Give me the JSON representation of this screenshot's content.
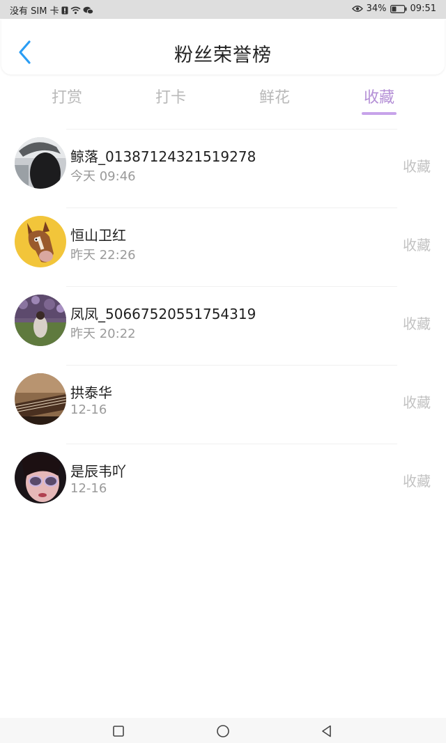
{
  "status_bar": {
    "carrier": "没有 SIM 卡",
    "battery": "34%",
    "time": "09:51"
  },
  "header": {
    "title": "粉丝荣誉榜",
    "back_icon": "chevron-left-icon",
    "accent": "#2a9df4"
  },
  "tabs": [
    {
      "label": "打赏",
      "active": false
    },
    {
      "label": "打卡",
      "active": false
    },
    {
      "label": "鲜花",
      "active": false
    },
    {
      "label": "收藏",
      "active": true
    }
  ],
  "active_tab_color": "#b48fd6",
  "fans": [
    {
      "name": "鲸落_01387124321519278",
      "time": "今天 09:46",
      "action": "收藏"
    },
    {
      "name": "恒山卫红",
      "time": "昨天 22:26",
      "action": "收藏"
    },
    {
      "name": "凤凤_50667520551754319",
      "time": "昨天 20:22",
      "action": "收藏"
    },
    {
      "name": "拱泰华",
      "time": "12-16",
      "action": "收藏"
    },
    {
      "name": "是辰韦吖",
      "time": "12-16",
      "action": "收藏"
    }
  ],
  "nav_bar": {
    "icons": [
      "recents-square-icon",
      "home-circle-icon",
      "back-triangle-icon"
    ]
  }
}
